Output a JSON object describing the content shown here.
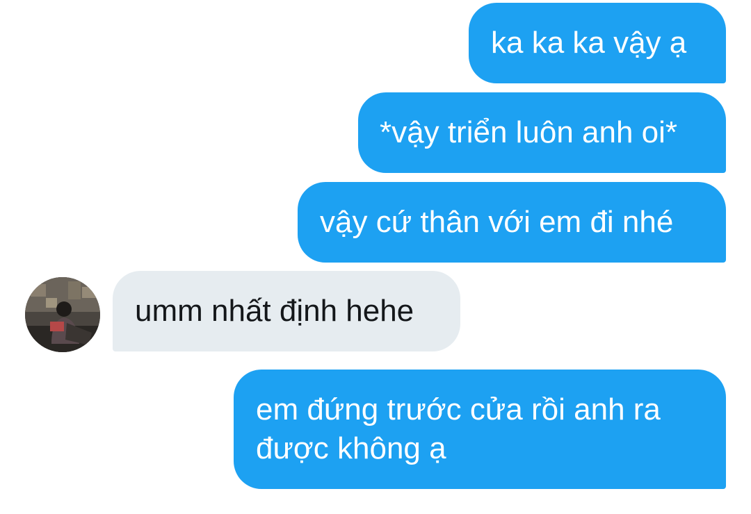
{
  "conversation": {
    "messages": [
      {
        "direction": "outgoing",
        "text": "ka ka ka vậy ạ"
      },
      {
        "direction": "outgoing",
        "text": "*vậy triển luôn anh oi*"
      },
      {
        "direction": "outgoing",
        "text": "vậy cứ thân với em đi nhé"
      },
      {
        "direction": "incoming",
        "text": "umm nhất định hehe"
      },
      {
        "direction": "outgoing",
        "text": "em đứng trước cửa rồi anh ra được không ạ"
      }
    ]
  },
  "colors": {
    "outgoing_bubble": "#1da1f2",
    "incoming_bubble": "#e6ecf0",
    "outgoing_text": "#ffffff",
    "incoming_text": "#14171a"
  },
  "icons": {
    "sender_avatar": "avatar-photo"
  }
}
